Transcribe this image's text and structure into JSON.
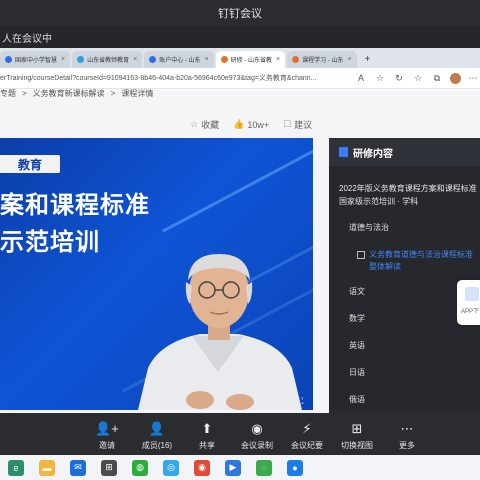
{
  "app": {
    "title": "钉钉会议"
  },
  "banner": {
    "text": "人在会议中"
  },
  "browser": {
    "tabs": [
      {
        "label": "国家中小学智慧",
        "fav_color": "#2f6fe0",
        "active": false
      },
      {
        "label": "山东省教师教育",
        "fav_color": "#2f9be0",
        "active": false
      },
      {
        "label": "账户中心 - 山东",
        "fav_color": "#2f6fe0",
        "active": false
      },
      {
        "label": "研修 - 山东省教",
        "fav_color": "#e0702f",
        "active": true
      },
      {
        "label": "课程学习 - 山东",
        "fav_color": "#e0702f",
        "active": false
      }
    ],
    "new_tab": "+",
    "close_mark": "×",
    "url": "erTraining/courseDetail?courseId=91094163-8b46-404a-b20a-56964c60e973&tag=义务教育&chann...",
    "icons": [
      "A",
      "☆",
      "↻",
      "☆",
      "⧉",
      "⋯"
    ]
  },
  "page": {
    "breadcrumb": [
      "专题",
      ">",
      "义务教育新课标解读",
      ">",
      "课程详情"
    ],
    "favorite": {
      "icon": "☆",
      "label": "收藏"
    },
    "likes": {
      "icon": "👍",
      "count": "10w+"
    },
    "suggest": {
      "icon": "☐",
      "label": "建议"
    }
  },
  "video": {
    "badge": "教育",
    "title_line1": "案和课程标准",
    "title_line2": "示范培训",
    "fullscreen_icon": "⛶"
  },
  "side_panel": {
    "title": "研修内容",
    "course_title": "2022年版义务教育课程方案和课程标准国家级示范培训 · 学科",
    "active_category": "道德与法治",
    "active_lesson": "义务教育道德与法治课程标准整体解读",
    "categories": [
      "语文",
      "数学",
      "英语",
      "日语",
      "俄语"
    ],
    "app_label": "APP下"
  },
  "toolbar": {
    "items": [
      {
        "icon": "👤+",
        "label": "邀请"
      },
      {
        "icon": "👤",
        "label": "成员(16)"
      },
      {
        "icon": "⬆",
        "label": "共享"
      },
      {
        "icon": "◉",
        "label": "会议录制"
      },
      {
        "icon": "⚡",
        "label": "会议纪要"
      },
      {
        "icon": "⊞",
        "label": "切换视图"
      },
      {
        "icon": "⋯",
        "label": "更多"
      }
    ]
  },
  "taskbar": {
    "apps": [
      {
        "name": "edge",
        "color": "#2a8f6a",
        "glyph": "e"
      },
      {
        "name": "explorer",
        "color": "#f1b63b",
        "glyph": "▬"
      },
      {
        "name": "mail",
        "color": "#1d6ed6",
        "glyph": "✉"
      },
      {
        "name": "apps",
        "color": "#4a4a4a",
        "glyph": "⊞"
      },
      {
        "name": "wechat",
        "color": "#2aae3c",
        "glyph": "◍"
      },
      {
        "name": "dingtalk",
        "color": "#37a7e8",
        "glyph": "◎"
      },
      {
        "name": "chrome",
        "color": "#e04a3a",
        "glyph": "◉"
      },
      {
        "name": "lark",
        "color": "#2f77e0",
        "glyph": "▶"
      },
      {
        "name": "messenger",
        "color": "#3aaa4a",
        "glyph": "◌"
      },
      {
        "name": "meeting",
        "color": "#1e7be8",
        "glyph": "●"
      }
    ]
  }
}
